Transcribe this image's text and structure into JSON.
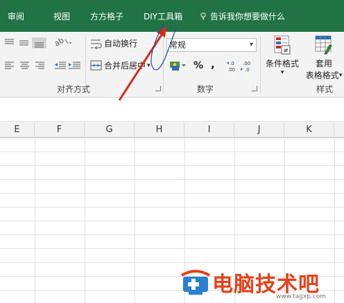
{
  "tabs": [
    {
      "label": "审阅"
    },
    {
      "label": "视图"
    },
    {
      "label": "方方格子"
    },
    {
      "label": "DIY工具箱"
    }
  ],
  "tell_me": "告诉我你想要做什么",
  "ribbon": {
    "wrap_text": "自动换行",
    "merge_center": "合并后居中",
    "merge_center_arrow": "▾",
    "alignment_group": "对齐方式",
    "number_format_value": "常规",
    "number_group": "数字",
    "percent": "%",
    "comma": ",",
    "inc_decimal": "←.0\n.00",
    "dec_decimal": ".00\n→.0",
    "cond_format": "条件格式",
    "cond_format_arrow": "▾",
    "table_format_1": "套用",
    "table_format_2": "表格格式",
    "table_format_arrow": "▾",
    "styles_group": "样式"
  },
  "columns": [
    "E",
    "F",
    "G",
    "H",
    "I",
    "J",
    "K"
  ],
  "watermark": {
    "text": "电脑技术吧",
    "url": "www.tagxp.com"
  },
  "colors": {
    "accent": "#217346",
    "arrow": "#d9261c",
    "watermark": "#e8401a"
  }
}
